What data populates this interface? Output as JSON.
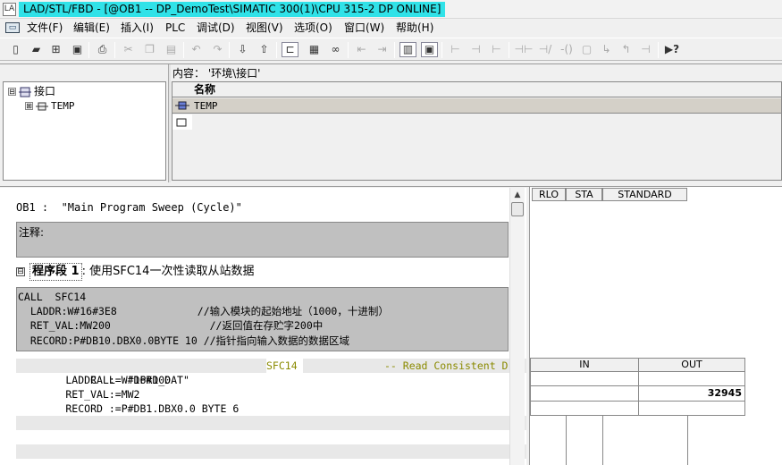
{
  "window": {
    "title": "LAD/STL/FBD  - [@OB1 -- DP_DemoTest\\SIMATIC 300(1)\\CPU 315-2 DP  ONLINE]"
  },
  "menu": [
    {
      "label": "文件(F)"
    },
    {
      "label": "编辑(E)"
    },
    {
      "label": "插入(I)"
    },
    {
      "label": "PLC"
    },
    {
      "label": "调试(D)"
    },
    {
      "label": "视图(V)"
    },
    {
      "label": "选项(O)"
    },
    {
      "label": "窗口(W)"
    },
    {
      "label": "帮助(H)"
    }
  ],
  "toolbar": {
    "icons": [
      "new-icon",
      "open-icon",
      "accessible-nodes-icon",
      "save-icon",
      "print-icon",
      "cut-icon",
      "copy-icon",
      "paste-icon",
      "undo-icon",
      "redo-icon",
      "download-icon",
      "upload-icon",
      "monitor-icon",
      "overview-icon",
      "glasses-icon",
      "prev-network-icon",
      "next-network-icon",
      "program-elements-icon",
      "detail-view-icon",
      "branch-icon",
      "no-contact-icon",
      "nc-contact-icon",
      "coil-icon",
      "box-icon",
      "open-branch-icon",
      "close-branch-icon",
      "connection-icon",
      "help-icon"
    ],
    "labels": {
      "no_contact": "⊣⊢",
      "nc_contact": "⊣/⊢",
      "coil": "-()",
      "help": "▶?"
    }
  },
  "interface": {
    "path_label": "内容：  '环境\\接口'",
    "tree": [
      {
        "label": "接口",
        "expand": "⊟"
      },
      {
        "label": "TEMP",
        "expand": "⊞"
      }
    ],
    "column_name": "名称",
    "rows": [
      {
        "name": "TEMP"
      }
    ]
  },
  "editor": {
    "block_title": "OB1 :  \"Main Program Sweep (Cycle)\"",
    "comment_label": "注释:",
    "network": {
      "collapse": "⊟",
      "label": "程序段 1",
      "title": ": 使用SFC14一次性读取从站数据"
    },
    "code_lines": [
      "CALL  SFC14",
      "  LADDR:W#16#3E8             //输入模块的起始地址（1000，十进制）",
      "  RET_VAL:MW200                //返回值在存贮字200中",
      "  RECORD:P#DB10.DBX0.0BYTE 10 //指针指向输入数据的数据区域"
    ],
    "stl_lines": [
      {
        "text": "      CALL  \"DPRD_DAT\"",
        "sym": "SFC14",
        "cmt": "-- Read Consistent D"
      },
      {
        "text": "        LADDR  :=W#16#100"
      },
      {
        "text": "        RET_VAL:=MW2"
      },
      {
        "text": "        RECORD :=P#DB1.DBX0.0 BYTE 6"
      }
    ]
  },
  "status": {
    "headers": [
      "RLO",
      "STA",
      "STANDARD"
    ],
    "io_headers": [
      "IN",
      "OUT"
    ],
    "out_values": [
      "",
      "32945"
    ]
  },
  "colors": {
    "title_highlight": "#30e2e8",
    "code_box": "#c0c0c0",
    "symbol_text": "#8a8a00"
  }
}
